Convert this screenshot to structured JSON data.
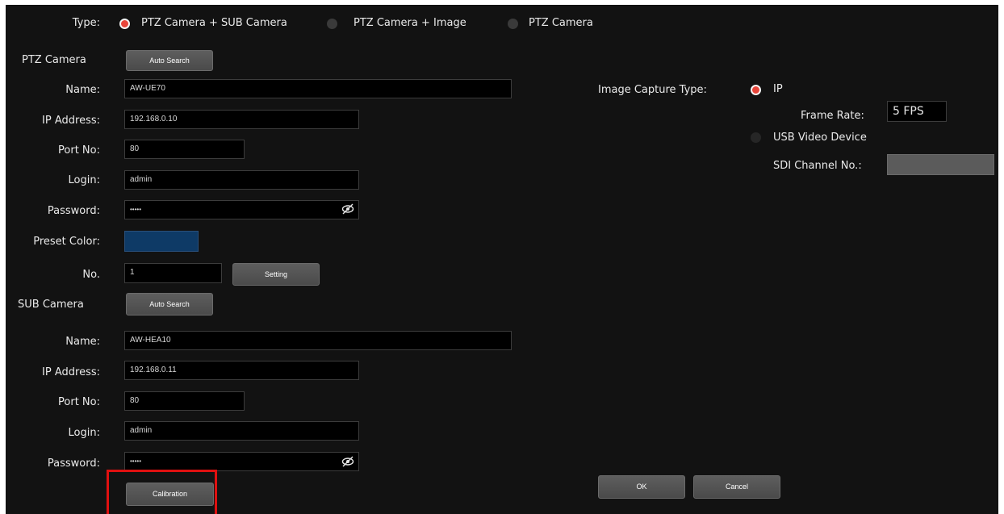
{
  "type_row": {
    "label": "Type:",
    "options": [
      {
        "label": "PTZ Camera + SUB Camera",
        "selected": true
      },
      {
        "label": "PTZ Camera + Image",
        "selected": false
      },
      {
        "label": "PTZ Camera",
        "selected": false
      }
    ]
  },
  "ptz": {
    "section_label": "PTZ Camera",
    "auto_search_label": "Auto Search",
    "name_label": "Name:",
    "name_value": "AW-UE70",
    "ip_label": "IP Address:",
    "ip_value": "192.168.0.10",
    "port_label": "Port No:",
    "port_value": "80",
    "login_label": "Login:",
    "login_value": "admin",
    "password_label": "Password:",
    "password_value": "•••••",
    "preset_color_label": "Preset Color:",
    "preset_color": "#0e3a66",
    "no_label": "No.",
    "no_value": "1",
    "setting_label": "Setting"
  },
  "sub": {
    "section_label": "SUB Camera",
    "auto_search_label": "Auto Search",
    "name_label": "Name:",
    "name_value": "AW-HEA10",
    "ip_label": "IP Address:",
    "ip_value": "192.168.0.11",
    "port_label": "Port No:",
    "port_value": "80",
    "login_label": "Login:",
    "login_value": "admin",
    "password_label": "Password:",
    "password_value": "•••••",
    "calibration_label": "Calibration"
  },
  "image_capture": {
    "label": "Image Capture Type:",
    "ip_option": "IP",
    "ip_selected": true,
    "frame_rate_label": "Frame Rate:",
    "frame_rate_value": "5 FPS",
    "usb_option": "USB Video Device",
    "usb_selected": false,
    "sdi_label": "SDI Channel No.:",
    "sdi_value": ""
  },
  "footer": {
    "ok_label": "OK",
    "cancel_label": "Cancel"
  },
  "colors": {
    "background": "#121212",
    "radio_selected": "#e8453a",
    "highlight": "#e01010"
  },
  "icons": {
    "password_visibility": "eye-slash-icon"
  }
}
